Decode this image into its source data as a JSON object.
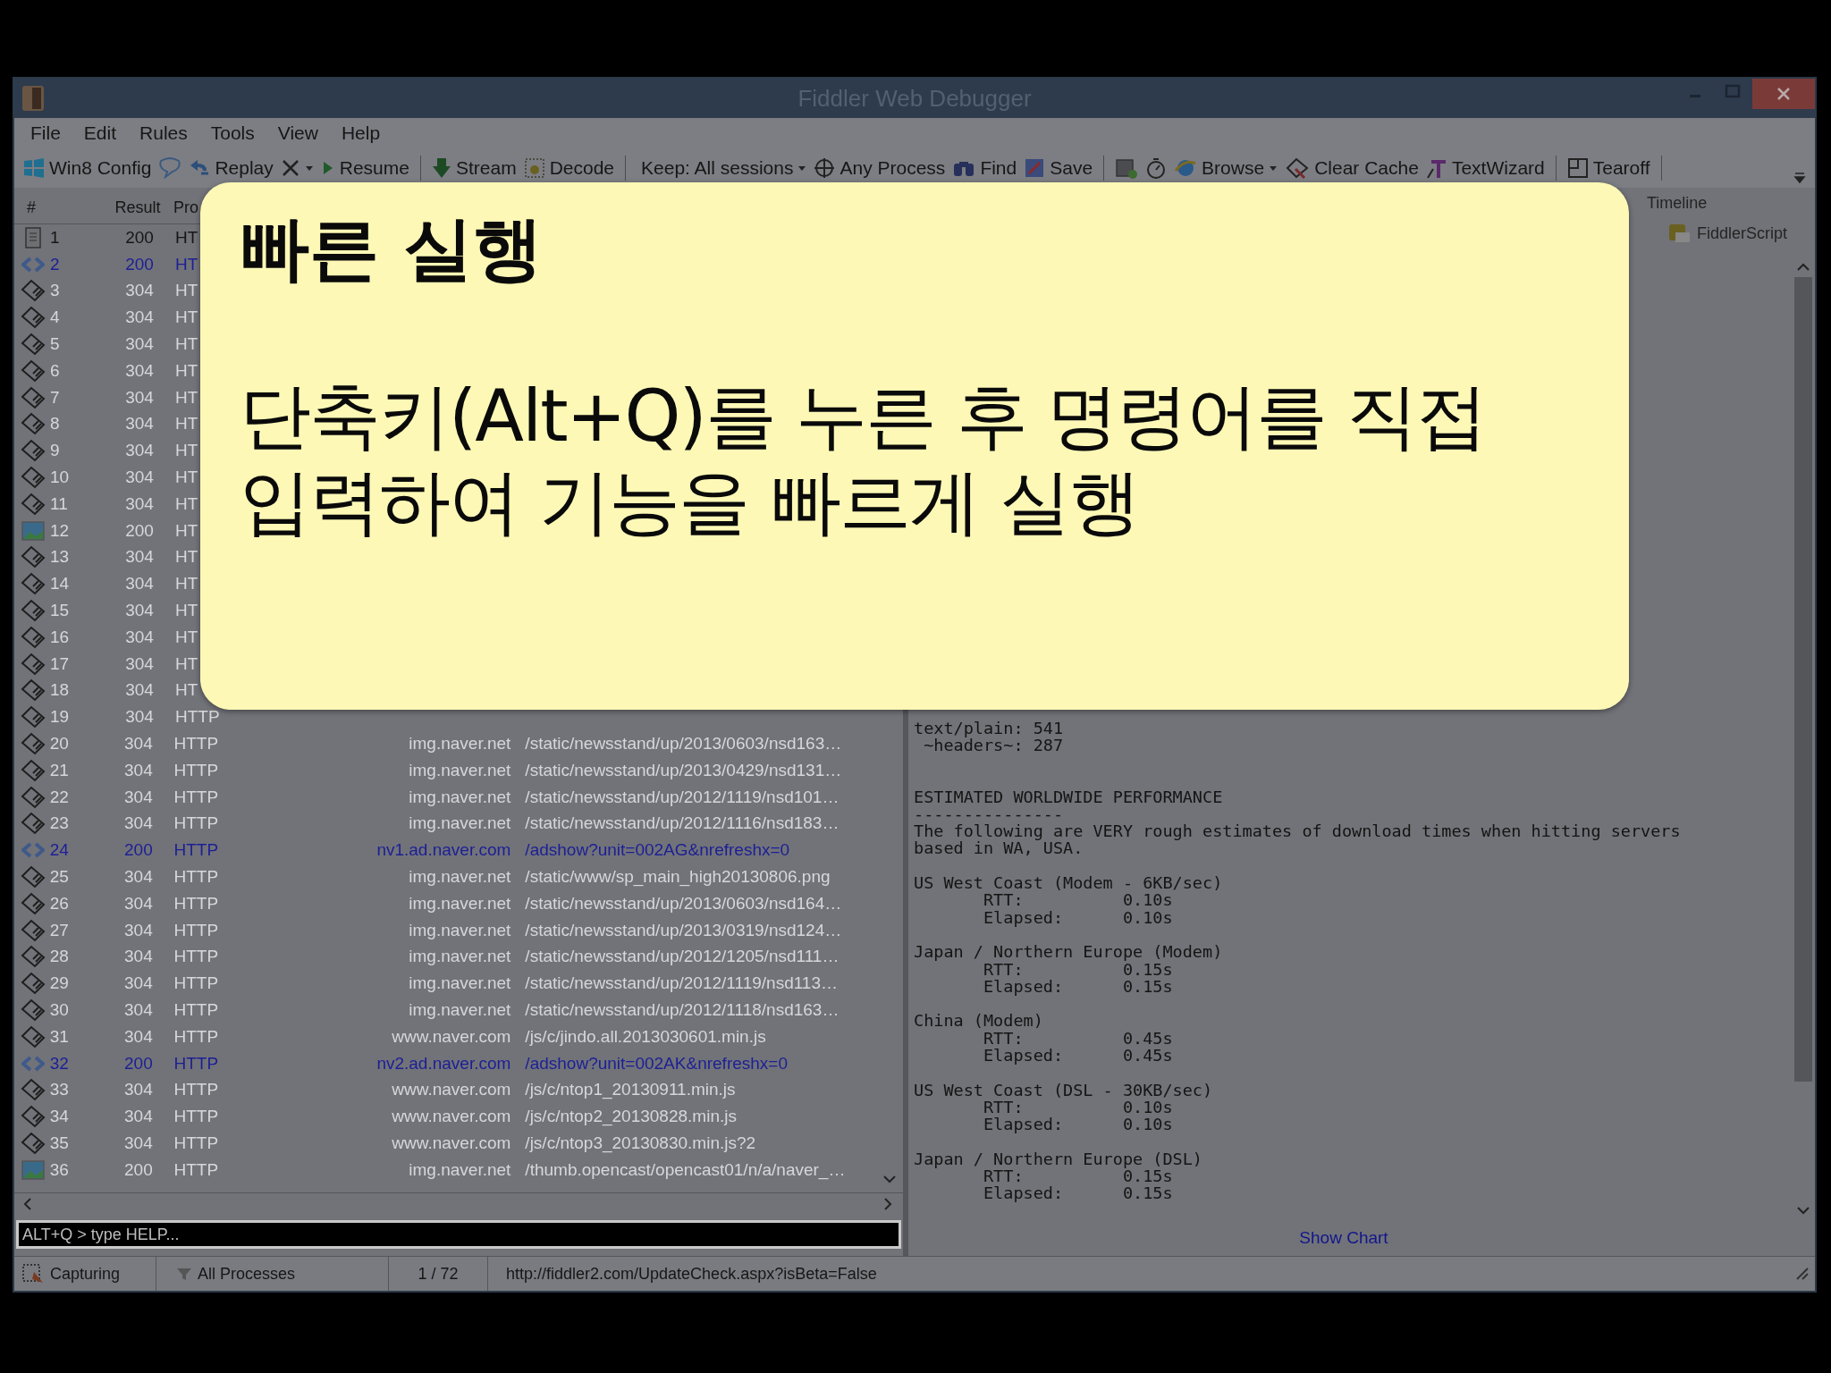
{
  "window": {
    "title": "Fiddler Web Debugger"
  },
  "menu": [
    "File",
    "Edit",
    "Rules",
    "Tools",
    "View",
    "Help"
  ],
  "toolbar": [
    {
      "kind": "win",
      "label": "Win8 Config"
    },
    {
      "kind": "comment"
    },
    {
      "kind": "replay",
      "label": "Replay"
    },
    {
      "kind": "remove",
      "dropdown": true
    },
    {
      "kind": "resume",
      "label": "Resume"
    },
    {
      "kind": "sep"
    },
    {
      "kind": "stream",
      "label": "Stream"
    },
    {
      "kind": "decode",
      "label": "Decode"
    },
    {
      "kind": "sep"
    },
    {
      "kind": "plain",
      "label": "Keep: All sessions",
      "dropdown": true
    },
    {
      "kind": "target",
      "label": "Any Process"
    },
    {
      "kind": "find",
      "label": "Find"
    },
    {
      "kind": "save",
      "label": "Save"
    },
    {
      "kind": "sep"
    },
    {
      "kind": "camera"
    },
    {
      "kind": "timer"
    },
    {
      "kind": "browse",
      "label": "Browse",
      "dropdown": true
    },
    {
      "kind": "clear",
      "label": "Clear Cache"
    },
    {
      "kind": "textwizard",
      "label": "TextWizard"
    },
    {
      "kind": "sep"
    },
    {
      "kind": "tearoff",
      "label": "Tearoff"
    },
    {
      "kind": "sep"
    }
  ],
  "sessions": {
    "columns": [
      "#",
      "Result",
      "Pro"
    ],
    "rows": [
      {
        "num": "1",
        "kind": "document",
        "color": "#161616",
        "result": "200",
        "protocol": "HT"
      },
      {
        "num": "2",
        "kind": "script",
        "color": "#1c1f96",
        "result": "200",
        "protocol": "HT"
      },
      {
        "num": "3",
        "kind": "cached",
        "color": "#d6d7da",
        "result": "304",
        "protocol": "HT"
      },
      {
        "num": "4",
        "kind": "cached",
        "color": "#d6d7da",
        "result": "304",
        "protocol": "HT"
      },
      {
        "num": "5",
        "kind": "cached",
        "color": "#d6d7da",
        "result": "304",
        "protocol": "HT"
      },
      {
        "num": "6",
        "kind": "cached",
        "color": "#d6d7da",
        "result": "304",
        "protocol": "HT"
      },
      {
        "num": "7",
        "kind": "cached",
        "color": "#d6d7da",
        "result": "304",
        "protocol": "HT"
      },
      {
        "num": "8",
        "kind": "cached",
        "color": "#d6d7da",
        "result": "304",
        "protocol": "HT"
      },
      {
        "num": "9",
        "kind": "cached",
        "color": "#d6d7da",
        "result": "304",
        "protocol": "HT"
      },
      {
        "num": "10",
        "kind": "cached",
        "color": "#d6d7da",
        "result": "304",
        "protocol": "HT"
      },
      {
        "num": "11",
        "kind": "cached",
        "color": "#d6d7da",
        "result": "304",
        "protocol": "HT"
      },
      {
        "num": "12",
        "kind": "image",
        "color": "#d6d7da",
        "result": "200",
        "protocol": "HT"
      },
      {
        "num": "13",
        "kind": "cached",
        "color": "#d6d7da",
        "result": "304",
        "protocol": "HT"
      },
      {
        "num": "14",
        "kind": "cached",
        "color": "#d6d7da",
        "result": "304",
        "protocol": "HT"
      },
      {
        "num": "15",
        "kind": "cached",
        "color": "#d6d7da",
        "result": "304",
        "protocol": "HT"
      },
      {
        "num": "16",
        "kind": "cached",
        "color": "#d6d7da",
        "result": "304",
        "protocol": "HT"
      },
      {
        "num": "17",
        "kind": "cached",
        "color": "#d6d7da",
        "result": "304",
        "protocol": "HT"
      },
      {
        "num": "18",
        "kind": "cached",
        "color": "#d6d7da",
        "result": "304",
        "protocol": "HT"
      },
      {
        "num": "19",
        "kind": "cached",
        "color": "#d6d7da",
        "result": "304",
        "protocol": "HTTP"
      },
      {
        "num": "20",
        "kind": "cached",
        "color": "#d6d7da",
        "result": "304",
        "protocol": "HTTP",
        "host": "img.naver.net",
        "url": "/static/newsstand/up/2013/0603/nsd163…"
      },
      {
        "num": "21",
        "kind": "cached",
        "color": "#d6d7da",
        "result": "304",
        "protocol": "HTTP",
        "host": "img.naver.net",
        "url": "/static/newsstand/up/2013/0429/nsd131…"
      },
      {
        "num": "22",
        "kind": "cached",
        "color": "#d6d7da",
        "result": "304",
        "protocol": "HTTP",
        "host": "img.naver.net",
        "url": "/static/newsstand/up/2012/1119/nsd101…"
      },
      {
        "num": "23",
        "kind": "cached",
        "color": "#d6d7da",
        "result": "304",
        "protocol": "HTTP",
        "host": "img.naver.net",
        "url": "/static/newsstand/up/2012/1116/nsd183…"
      },
      {
        "num": "24",
        "kind": "script",
        "color": "#1c1f96",
        "result": "200",
        "protocol": "HTTP",
        "host": "nv1.ad.naver.com",
        "url": "/adshow?unit=002AG&nrefreshx=0"
      },
      {
        "num": "25",
        "kind": "cached",
        "color": "#d6d7da",
        "result": "304",
        "protocol": "HTTP",
        "host": "img.naver.net",
        "url": "/static/www/sp_main_high20130806.png"
      },
      {
        "num": "26",
        "kind": "cached",
        "color": "#d6d7da",
        "result": "304",
        "protocol": "HTTP",
        "host": "img.naver.net",
        "url": "/static/newsstand/up/2013/0603/nsd164…"
      },
      {
        "num": "27",
        "kind": "cached",
        "color": "#d6d7da",
        "result": "304",
        "protocol": "HTTP",
        "host": "img.naver.net",
        "url": "/static/newsstand/up/2013/0319/nsd124…"
      },
      {
        "num": "28",
        "kind": "cached",
        "color": "#d6d7da",
        "result": "304",
        "protocol": "HTTP",
        "host": "img.naver.net",
        "url": "/static/newsstand/up/2012/1205/nsd111…"
      },
      {
        "num": "29",
        "kind": "cached",
        "color": "#d6d7da",
        "result": "304",
        "protocol": "HTTP",
        "host": "img.naver.net",
        "url": "/static/newsstand/up/2012/1119/nsd113…"
      },
      {
        "num": "30",
        "kind": "cached",
        "color": "#d6d7da",
        "result": "304",
        "protocol": "HTTP",
        "host": "img.naver.net",
        "url": "/static/newsstand/up/2012/1118/nsd163…"
      },
      {
        "num": "31",
        "kind": "cached",
        "color": "#d6d7da",
        "result": "304",
        "protocol": "HTTP",
        "host": "www.naver.com",
        "url": "/js/c/jindo.all.2013030601.min.js"
      },
      {
        "num": "32",
        "kind": "script",
        "color": "#1c1f96",
        "result": "200",
        "protocol": "HTTP",
        "host": "nv2.ad.naver.com",
        "url": "/adshow?unit=002AK&nrefreshx=0"
      },
      {
        "num": "33",
        "kind": "cached",
        "color": "#d6d7da",
        "result": "304",
        "protocol": "HTTP",
        "host": "www.naver.com",
        "url": "/js/c/ntop1_20130911.min.js"
      },
      {
        "num": "34",
        "kind": "cached",
        "color": "#d6d7da",
        "result": "304",
        "protocol": "HTTP",
        "host": "www.naver.com",
        "url": "/js/c/ntop2_20130828.min.js"
      },
      {
        "num": "35",
        "kind": "cached",
        "color": "#d6d7da",
        "result": "304",
        "protocol": "HTTP",
        "host": "www.naver.com",
        "url": "/js/c/ntop3_20130830.min.js?2"
      },
      {
        "num": "36",
        "kind": "image",
        "color": "#d6d7da",
        "result": "200",
        "protocol": "HTTP",
        "host": "img.naver.net",
        "url": "/thumb.opencast/opencast01/n/a/naver_…"
      }
    ]
  },
  "quickexec": {
    "placeholder": "ALT+Q > type HELP..."
  },
  "inspector": {
    "tabs": [
      "Timeline",
      "FiddlerScript"
    ],
    "blocks": [
      [
        "text/plain: 541",
        " ~headers~: 287"
      ],
      [
        "ESTIMATED WORLDWIDE PERFORMANCE",
        "---------------",
        "The following are VERY rough estimates of download times when hitting servers",
        "based in WA, USA."
      ],
      [
        "US West Coast (Modem - 6KB/sec)",
        "       RTT:          0.10s",
        "       Elapsed:      0.10s"
      ],
      [
        "Japan / Northern Europe (Modem)",
        "       RTT:          0.15s",
        "       Elapsed:      0.15s"
      ],
      [
        "China (Modem)",
        "       RTT:          0.45s",
        "       Elapsed:      0.45s"
      ],
      [
        "US West Coast (DSL - 30KB/sec)",
        "       RTT:          0.10s",
        "       Elapsed:      0.10s"
      ],
      [
        "Japan / Northern Europe (DSL)",
        "       RTT:          0.15s",
        "       Elapsed:      0.15s"
      ]
    ],
    "link": "Show Chart"
  },
  "status_bar": {
    "capturing": "Capturing",
    "processes": "All Processes",
    "count": "1 / 72",
    "message": "http://fiddler2.com/UpdateCheck.aspx?isBeta=False"
  },
  "callout": {
    "title": "빠른 실행",
    "body": "단축키(Alt+Q)를 누른 후 명령어를 직접 입력하여 기능을 빠르게 실행"
  }
}
